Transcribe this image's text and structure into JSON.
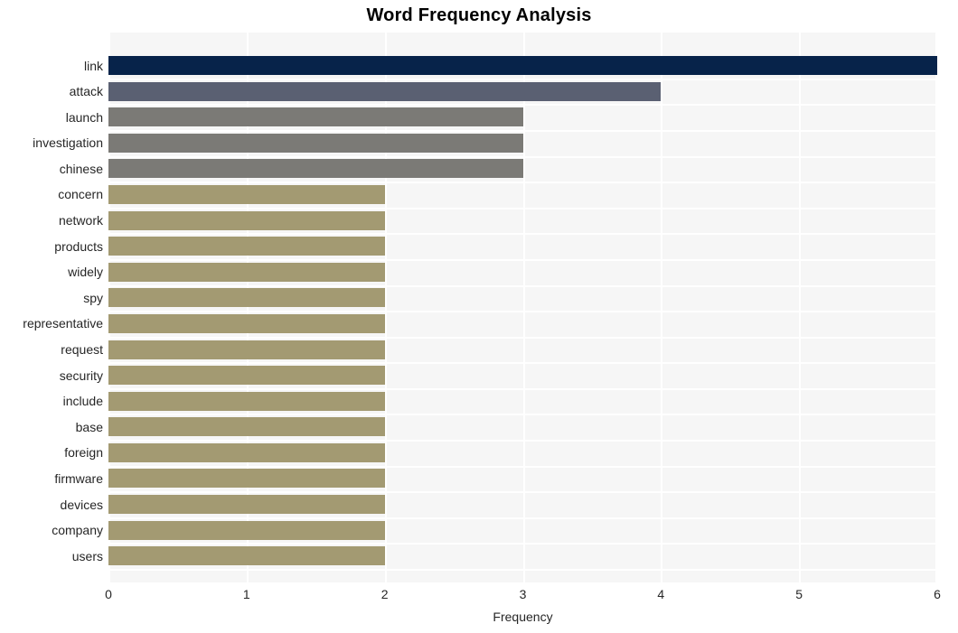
{
  "chart_data": {
    "type": "bar",
    "orientation": "horizontal",
    "title": "Word Frequency Analysis",
    "xlabel": "Frequency",
    "ylabel": "",
    "xlim": [
      0,
      6
    ],
    "xticks": [
      "0",
      "1",
      "2",
      "3",
      "4",
      "5",
      "6"
    ],
    "grid": true,
    "legend": "none",
    "categories": [
      "link",
      "attack",
      "launch",
      "investigation",
      "chinese",
      "concern",
      "network",
      "products",
      "widely",
      "spy",
      "representative",
      "request",
      "security",
      "include",
      "base",
      "foreign",
      "firmware",
      "devices",
      "company",
      "users"
    ],
    "values": [
      6,
      4,
      3,
      3,
      3,
      2,
      2,
      2,
      2,
      2,
      2,
      2,
      2,
      2,
      2,
      2,
      2,
      2,
      2,
      2
    ],
    "bar_colors": [
      "#07234a",
      "#5a6072",
      "#7b7a76",
      "#7b7a76",
      "#7b7a76",
      "#a39a72",
      "#a39a72",
      "#a39a72",
      "#a39a72",
      "#a39a72",
      "#a39a72",
      "#a39a72",
      "#a39a72",
      "#a39a72",
      "#a39a72",
      "#a39a72",
      "#a39a72",
      "#a39a72",
      "#a39a72",
      "#a39a72"
    ],
    "plot_background": "#f6f6f6",
    "gridline_color": "#ffffff",
    "text_color": "#262626"
  }
}
